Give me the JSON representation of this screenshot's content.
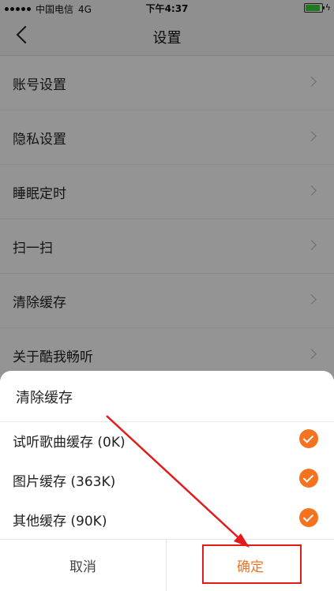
{
  "status_bar": {
    "carrier": "中国电信",
    "network": "4G",
    "time": "下午4:37"
  },
  "nav": {
    "title": "设置",
    "back_icon": "chevron-left-icon"
  },
  "settings": {
    "items": [
      {
        "label": "账号设置"
      },
      {
        "label": "隐私设置"
      },
      {
        "label": "睡眠定时"
      },
      {
        "label": "扫一扫"
      },
      {
        "label": "清除缓存"
      },
      {
        "label": "关于酷我畅听"
      }
    ]
  },
  "clear_cache_sheet": {
    "title": "清除缓存",
    "options": [
      {
        "label": "试听歌曲缓存 (0K)",
        "checked": true
      },
      {
        "label": "图片缓存 (363K)",
        "checked": true
      },
      {
        "label": "其他缓存 (90K)",
        "checked": true
      }
    ],
    "cancel_label": "取消",
    "confirm_label": "确定"
  },
  "colors": {
    "accent": "#f5731f",
    "annotation": "#e21a1a"
  }
}
